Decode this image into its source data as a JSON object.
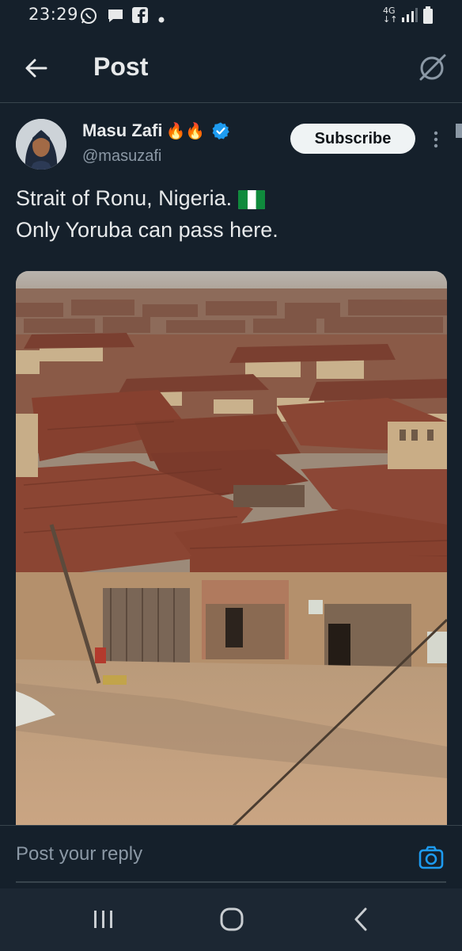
{
  "status_bar": {
    "time": "23:29",
    "network": "4G",
    "icons": [
      "whatsapp-icon",
      "message-icon",
      "facebook-icon",
      "dot-icon",
      "signal-icon",
      "battery-icon"
    ]
  },
  "header": {
    "back_icon": "arrow-left-icon",
    "title": "Post",
    "right_icon": "grok-icon"
  },
  "post": {
    "author": {
      "name": "Masu Zafi",
      "name_emojis": "🔥🔥",
      "handle": "@masuzafi",
      "verified": true
    },
    "subscribe_label": "Subscribe",
    "more_icon": "more-vertical-icon",
    "text_line1": "Strait of Ronu, Nigeria.",
    "text_line2": "Only Yoruba can pass here.",
    "flag_icon": "nigeria-flag-icon",
    "image": "photo-rusty-roofs-town"
  },
  "reply": {
    "placeholder": "Post your reply",
    "camera_icon": "camera-icon"
  },
  "nav": {
    "recents_icon": "recents-icon",
    "home_icon": "home-icon",
    "back_icon": "back-chevron-icon"
  },
  "colors": {
    "background": "#15202b",
    "text": "#e7e9ea",
    "muted": "#8b98a5",
    "accent": "#1d9bf0",
    "divider": "#38444d"
  }
}
